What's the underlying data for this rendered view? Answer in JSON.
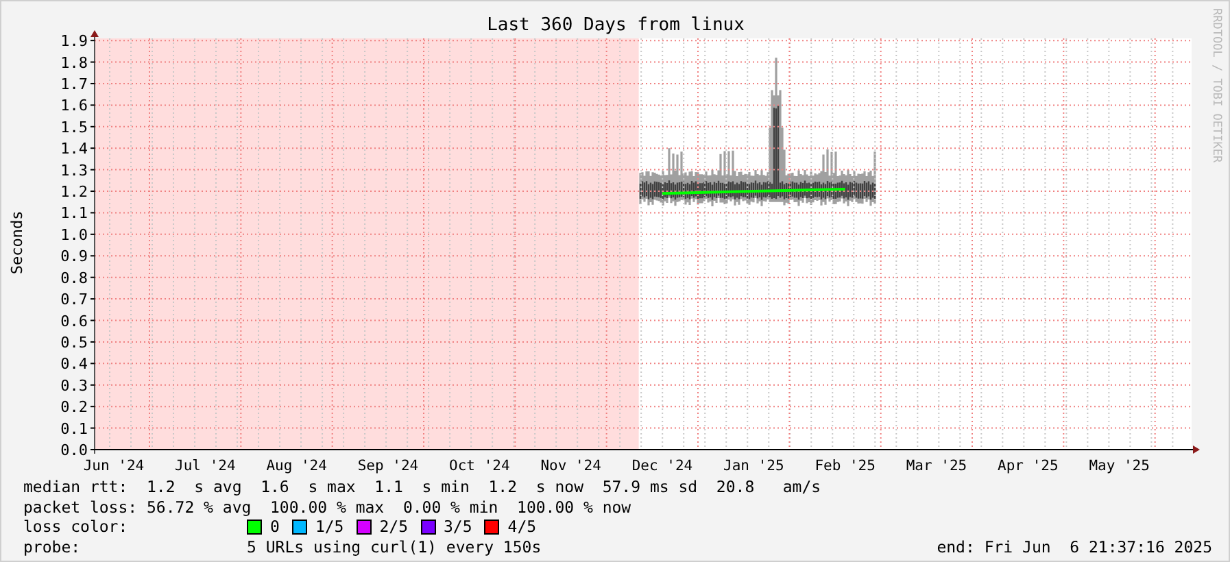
{
  "graph": {
    "side_text": "RRDTOOL / TOBI OETIKER",
    "no_data_band": {
      "level": 0.496
    },
    "chart_data": {
      "type": "line",
      "title": "Last 360 Days from linux",
      "ylabel": "Seconds",
      "categories": [
        "Jun '24",
        "Jul '24",
        "Aug '24",
        "Sep '24",
        "Oct '24",
        "Nov '24",
        "Dec '24",
        "Jan '25",
        "Feb '25",
        "Mar '25",
        "Apr '25",
        "May '25"
      ],
      "series": [
        {
          "color": "#00ff00",
          "values": [
            null,
            null,
            null,
            null,
            null,
            null,
            1.19,
            1.2,
            1.21,
            null,
            null,
            null
          ]
        }
      ],
      "ylim": [
        0,
        1.91
      ],
      "grid": true,
      "yticks": [
        {
          "value": 0,
          "label": "0.0"
        },
        {
          "value": 0.1,
          "label": "0.1"
        },
        {
          "value": 0.2,
          "label": "0.2"
        },
        {
          "value": 0.3,
          "label": "0.3"
        },
        {
          "value": 0.4,
          "label": "0.4"
        },
        {
          "value": 0.5,
          "label": "0.5"
        },
        {
          "value": 0.6,
          "label": "0.6"
        },
        {
          "value": 0.7,
          "label": "0.7"
        },
        {
          "value": 0.8,
          "label": "0.8"
        },
        {
          "value": 0.9,
          "label": "0.9"
        },
        {
          "value": 1,
          "label": "1.0"
        },
        {
          "value": 1.1,
          "label": "1.1"
        },
        {
          "value": 1.2,
          "label": "1.2"
        },
        {
          "value": 1.3,
          "label": "1.3"
        },
        {
          "value": 1.4,
          "label": "1.4"
        },
        {
          "value": 1.5,
          "label": "1.5"
        },
        {
          "value": 1.6,
          "label": "1.6"
        },
        {
          "value": 1.7,
          "label": "1.7"
        },
        {
          "value": 1.8,
          "label": "1.8"
        },
        {
          "value": 1.9,
          "label": "1.9"
        }
      ]
    }
  },
  "legend": {
    "lines": [
      {
        "kind": "text",
        "text": "median rtt:  1.2  s avg  1.6  s max  1.1  s min  1.2  s now  57.9 ms sd  20.8   am/s"
      },
      {
        "kind": "text",
        "text": "packet loss: 56.72 % avg  100.00 % max  0.00 % min  100.00 % now"
      },
      {
        "kind": "colors",
        "label": "loss color:",
        "items": [
          {
            "label": "0",
            "color": "#00ff00"
          },
          {
            "label": "1/5",
            "color": "#00b8ff"
          },
          {
            "label": "2/5",
            "color": "#d400ff"
          },
          {
            "label": "3/5",
            "color": "#7a00ff"
          },
          {
            "label": "4/5",
            "color": "#ff0000"
          }
        ]
      },
      {
        "kind": "probe",
        "label": "probe:",
        "text": "5 URLs using curl(1) every 150s",
        "end": "end: Fri Jun  6 21:37:16 2025"
      }
    ]
  }
}
